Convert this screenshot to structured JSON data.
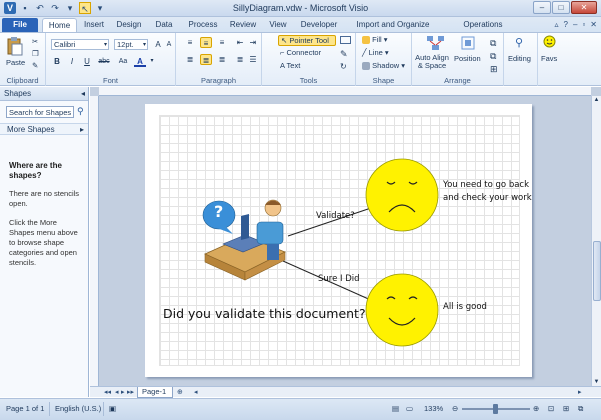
{
  "window": {
    "title": "SillyDiagram.vdw  -  Microsoft Visio"
  },
  "qat": {
    "app_icon": "V",
    "save_icon": "save-icon",
    "undo_icon": "undo-icon",
    "redo_icon": "redo-icon",
    "pointer_icon": "pointer-icon"
  },
  "tabs": [
    {
      "label": "File"
    },
    {
      "label": "Home"
    },
    {
      "label": "Insert"
    },
    {
      "label": "Design"
    },
    {
      "label": "Data"
    },
    {
      "label": "Process"
    },
    {
      "label": "Review"
    },
    {
      "label": "View"
    },
    {
      "label": "Developer"
    },
    {
      "label": "Import and Organize POC"
    },
    {
      "label": "Operations Manager"
    }
  ],
  "ribbon": {
    "clipboard": {
      "label": "Clipboard",
      "paste": "Paste"
    },
    "font": {
      "label": "Font",
      "family": "Calibri",
      "size": "12pt.",
      "bold": "B",
      "italic": "I",
      "underline": "U",
      "strike": "abc",
      "case": "Aa",
      "color": "A"
    },
    "paragraph": {
      "label": "Paragraph"
    },
    "tools": {
      "label": "Tools",
      "pointer": "Pointer Tool",
      "connector": "Connector",
      "text": "Text"
    },
    "shape": {
      "label": "Shape",
      "fill": "Fill",
      "line": "Line",
      "shadow": "Shadow"
    },
    "arrange": {
      "label": "Arrange",
      "auto_align": "Auto Align",
      "auto_align2": "& Space",
      "position": "Position"
    },
    "editing": {
      "label": "Editing"
    },
    "favs": {
      "label": "Favs"
    }
  },
  "shapes_pane": {
    "title": "Shapes",
    "search_placeholder": "Search for Shapes",
    "more_shapes": "More Shapes",
    "heading": "Where are the shapes?",
    "no_stencils": "There are no stencils open.",
    "instructions": "Click the More Shapes menu above to browse shape categories and open stencils."
  },
  "diagram": {
    "validate_label": "Validate?",
    "sure_label": "Sure I Did",
    "sad_text_1": "You need to go back",
    "sad_text_2": "and check your work",
    "happy_text": "All is good",
    "question": "Did you validate this document?",
    "bubble_mark": "?",
    "colors": {
      "face": "#fff200",
      "face_stroke": "#7a7a00",
      "bubble": "#3a8fd8"
    }
  },
  "page_tabs": {
    "current": "Page-1"
  },
  "status": {
    "page": "Page 1 of 1",
    "language": "English (U.S.)",
    "zoom": "133%"
  }
}
